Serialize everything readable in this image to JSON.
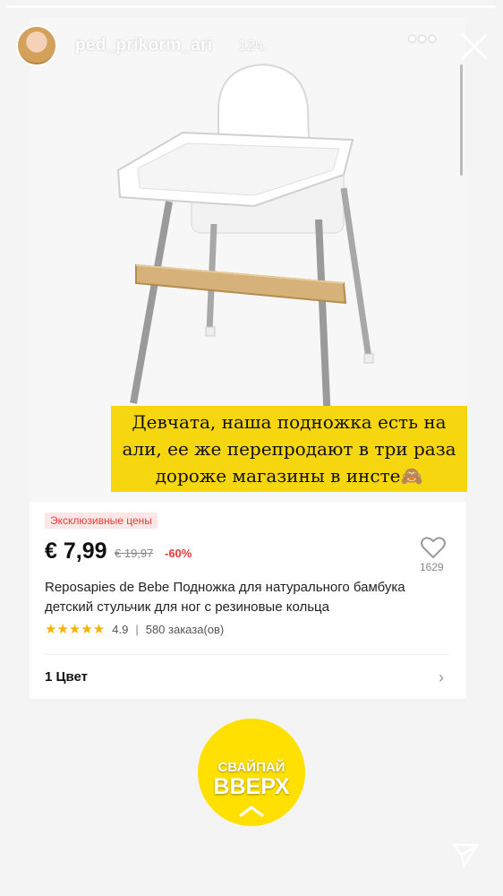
{
  "story": {
    "username": "ped_prikorm_ari",
    "time": "12ч.",
    "more_icon": "more-horizontal-icon",
    "close_icon": "close-icon"
  },
  "caption": {
    "text": "Девчата, наша подножка есть на али, ее же перепродают в три раза дороже магазины в инсте🙈"
  },
  "product": {
    "badge": "Эксклюзивные цены",
    "price": "€ 7,99",
    "old_price": "€ 19,97",
    "discount": "-60%",
    "likes": "1629",
    "title": "Reposapies de Bebe Подножка для натурального бамбука детский стульчик для ног с резиновые кольца",
    "stars": "★★★★★",
    "rating": "4.9",
    "orders": "580 заказа(ов)",
    "color_option": "1 Цвет"
  },
  "sticker": {
    "line1": "СВАЙПАЙ",
    "line2": "ВВЕРХ"
  },
  "colors": {
    "caption_bg": "#f6d60f",
    "sticker_bg": "#ffe000",
    "accent_red": "#e43b3b",
    "star": "#f5b400"
  }
}
